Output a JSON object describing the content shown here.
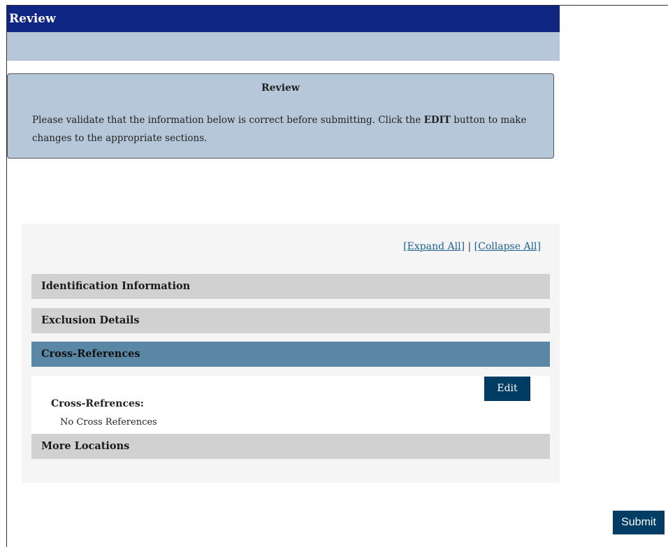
{
  "header": {
    "title": "Review"
  },
  "notice": {
    "title": "Review",
    "text_before": "Please validate that the information below is correct before submitting. Click the ",
    "text_bold": "EDIT",
    "text_after": " button to make changes to the appropriate sections."
  },
  "toggles": {
    "expand_all": "[Expand All]",
    "separator": "|",
    "collapse_all": "[Collapse All]"
  },
  "sections": [
    {
      "label": "Identification Information",
      "expanded": false
    },
    {
      "label": "Exclusion Details",
      "expanded": false
    },
    {
      "label": "Cross-References",
      "expanded": true
    },
    {
      "label": "More Locations",
      "expanded": false
    }
  ],
  "cross_references": {
    "edit_label": "Edit",
    "field_label": "Cross-Refrences:",
    "field_value": "No Cross References"
  },
  "footer": {
    "submit_label": "Submit"
  },
  "colors": {
    "header_bg": "#102683",
    "subheader_bg": "#b5c7d8",
    "active_section_bg": "#5a87a6",
    "section_bg": "#d1d1d1",
    "button_bg": "#003c64",
    "link": "#1a5f8f"
  }
}
